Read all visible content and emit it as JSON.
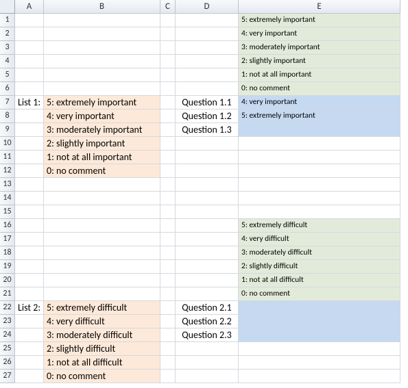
{
  "columns": [
    "A",
    "B",
    "C",
    "D",
    "E"
  ],
  "rowCount": 27,
  "lists": {
    "list1": {
      "label": "List 1:",
      "items": [
        "5: extremely important",
        "4: very important",
        "3: moderately important",
        "2: slightly important",
        "1: not at all important",
        "0: no comment"
      ]
    },
    "list2": {
      "label": "List 2:",
      "items": [
        "5: extremely difficult",
        "4: very difficult",
        "3: moderately difficult",
        "2: slightly difficult",
        "1: not at all difficult",
        "0: no comment"
      ]
    }
  },
  "questions": {
    "set1": [
      "Question 1.1",
      "Question 1.2",
      "Question 1.3"
    ],
    "set2": [
      "Question 2.1",
      "Question 2.2",
      "Question 2.3"
    ]
  },
  "dropdown1": {
    "options": [
      "5: extremely important",
      "4: very important",
      "3: moderately important",
      "2: slightly important",
      "1: not at all important",
      "0: no comment"
    ],
    "selected": [
      "4: very important",
      "5: extremely important"
    ]
  },
  "dropdown2": {
    "options": [
      "5: extremely difficult",
      "4: very difficult",
      "3: moderately difficult",
      "2: slightly difficult",
      "1: not at all difficult",
      "0: no comment"
    ],
    "selected": []
  }
}
